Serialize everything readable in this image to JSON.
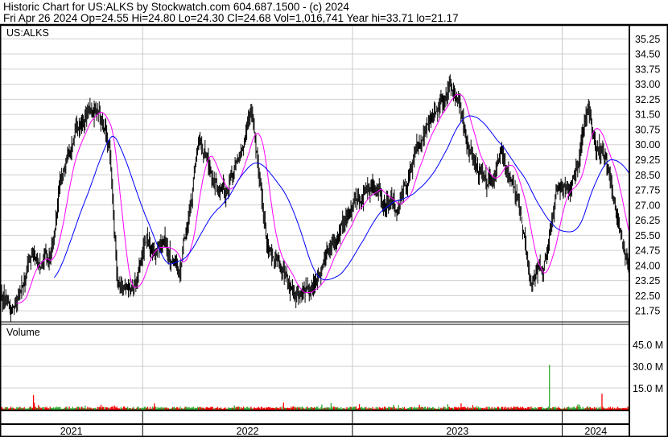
{
  "header": {
    "title": "Historic Chart for US:ALKS by Stockwatch.com 604.687.1500 - (c) 2024",
    "quote": "Fri Apr 26 2024   Op=24.55  Hi=24.80  Lo=24.30  Cl=24.68  Vol=1,016,741   Year hi=33.71  lo=21.17"
  },
  "chart_data": {
    "type": "line",
    "symbol_label": "US:ALKS",
    "volume_label": "Volume",
    "price_ticks": [
      "21.75",
      "22.50",
      "23.25",
      "24.00",
      "24.75",
      "25.50",
      "26.25",
      "27.00",
      "27.75",
      "28.50",
      "29.25",
      "30.00",
      "30.75",
      "31.50",
      "32.25",
      "33.00",
      "33.75",
      "34.50",
      "35.25"
    ],
    "price_range": [
      21.2,
      35.9
    ],
    "volume_ticks": [
      {
        "v": 15,
        "label": "15.0 M"
      },
      {
        "v": 30,
        "label": "30.0 M"
      },
      {
        "v": 45,
        "label": "45.0 M"
      }
    ],
    "volume_range": [
      0,
      59
    ],
    "years": [
      {
        "label": "2021",
        "start": 2021.32,
        "end": 2022.0
      },
      {
        "label": "2022",
        "start": 2022.0,
        "end": 2023.0
      },
      {
        "label": "2023",
        "start": 2023.0,
        "end": 2024.0
      },
      {
        "label": "2024",
        "start": 2024.0,
        "end": 2024.32
      }
    ],
    "time_range": [
      2021.32,
      2024.32
    ],
    "price_keypoints": [
      [
        2021.32,
        22.5
      ],
      [
        2021.4,
        22.0
      ],
      [
        2021.47,
        24.5
      ],
      [
        2021.55,
        24.0
      ],
      [
        2021.63,
        29.5
      ],
      [
        2021.71,
        31.0
      ],
      [
        2021.78,
        32.0
      ],
      [
        2021.84,
        30.0
      ],
      [
        2021.88,
        23.5
      ],
      [
        2021.94,
        22.3
      ],
      [
        2022.0,
        24.5
      ],
      [
        2022.09,
        25.0
      ],
      [
        2022.17,
        23.5
      ],
      [
        2022.27,
        30.0
      ],
      [
        2022.34,
        28.0
      ],
      [
        2022.4,
        27.5
      ],
      [
        2022.48,
        30.0
      ],
      [
        2022.52,
        31.5
      ],
      [
        2022.59,
        25.0
      ],
      [
        2022.67,
        23.5
      ],
      [
        2022.75,
        22.5
      ],
      [
        2022.83,
        23.5
      ],
      [
        2022.9,
        25.0
      ],
      [
        2023.02,
        27.5
      ],
      [
        2023.1,
        28.0
      ],
      [
        2023.21,
        26.5
      ],
      [
        2023.29,
        29.0
      ],
      [
        2023.37,
        31.0
      ],
      [
        2023.48,
        33.0
      ],
      [
        2023.56,
        30.0
      ],
      [
        2023.64,
        28.0
      ],
      [
        2023.71,
        29.5
      ],
      [
        2023.79,
        27.0
      ],
      [
        2023.85,
        23.5
      ],
      [
        2023.91,
        24.0
      ],
      [
        2023.98,
        28.0
      ],
      [
        2024.06,
        28.5
      ],
      [
        2024.13,
        32.0
      ],
      [
        2024.16,
        29.5
      ],
      [
        2024.2,
        29.5
      ],
      [
        2024.25,
        27.0
      ],
      [
        2024.31,
        23.5
      ],
      [
        2024.32,
        24.68
      ]
    ],
    "volume_spikes": [
      [
        2021.48,
        10
      ],
      [
        2023.94,
        31
      ],
      [
        2024.19,
        11
      ]
    ],
    "ma_short_color": "#ff00ff",
    "ma_long_color": "#0000ff",
    "up_color": "#33aa33",
    "down_color": "#ff0000"
  }
}
